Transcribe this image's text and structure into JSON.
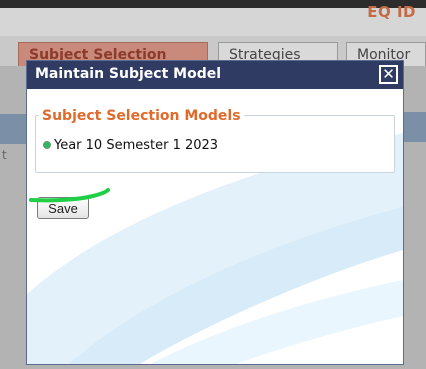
{
  "background": {
    "doc_code": "EQ ID",
    "tabs": [
      {
        "label": "Subject Selection",
        "active": true
      },
      {
        "label": "Strategies",
        "active": false
      },
      {
        "label": "Monitor",
        "active": false
      }
    ],
    "left_fragment": "t"
  },
  "dialog": {
    "title": "Maintain Subject Model",
    "close_icon": "close-icon",
    "section_title": "Subject Selection Models",
    "models": [
      {
        "label": "Year 10 Semester 1 2023",
        "selected": true
      }
    ],
    "save_label": "Save"
  },
  "colors": {
    "dialog_title_bar": "#2f3b63",
    "section_title": "#e06a2c",
    "selected_indicator": "#2fb85d",
    "annotation_underline": "#1fcf45"
  }
}
